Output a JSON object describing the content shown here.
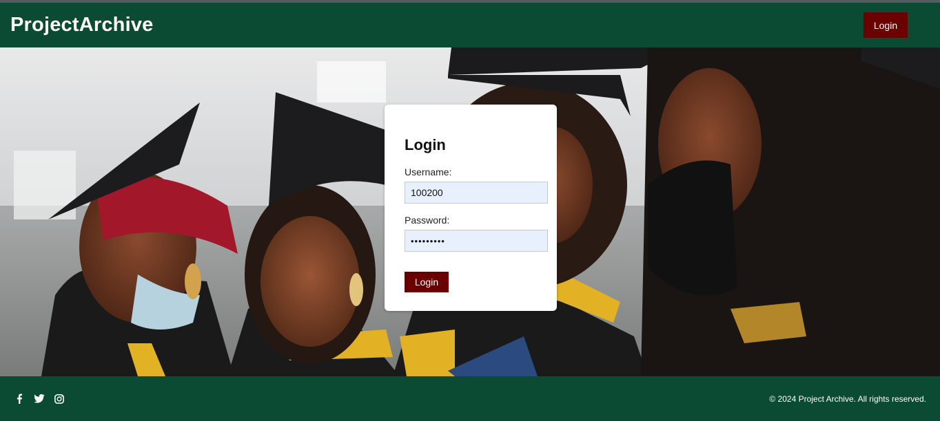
{
  "header": {
    "brand": "ProjectArchive",
    "login_label": "Login"
  },
  "hero": {
    "image_icon": "graduates-photo"
  },
  "login_form": {
    "title": "Login",
    "username_label": "Username:",
    "username_value": "100200",
    "password_label": "Password:",
    "password_value": "•••••••••",
    "submit_label": "Login"
  },
  "footer": {
    "social_icons": [
      "facebook-icon",
      "twitter-icon",
      "instagram-icon"
    ],
    "copyright": "© 2024 Project Archive. All rights reserved."
  },
  "colors": {
    "primary": "#0b4a33",
    "accent": "#6b0000",
    "input_bg": "#e8f0fe"
  }
}
